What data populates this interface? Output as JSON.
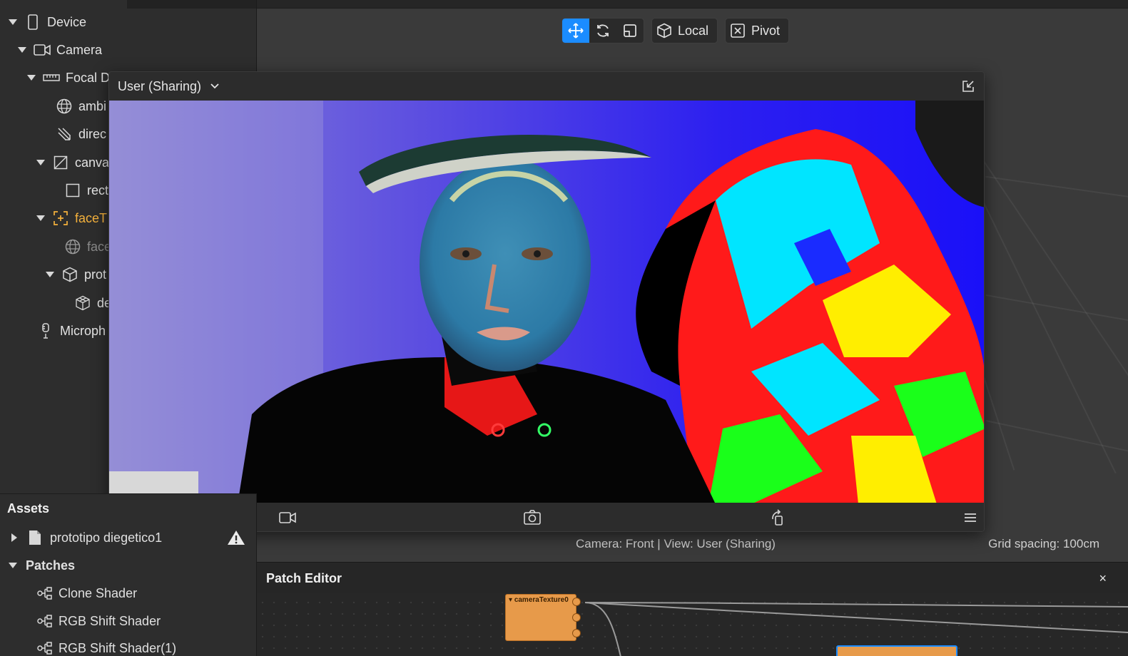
{
  "scene": {
    "items": [
      {
        "label": "Device",
        "icon": "phone-icon"
      },
      {
        "label": "Camera",
        "icon": "camera-icon"
      },
      {
        "label": "Focal D",
        "icon": "ruler-icon"
      },
      {
        "label": "ambi",
        "icon": "globe-icon"
      },
      {
        "label": "direc",
        "icon": "directional-light-icon"
      },
      {
        "label": "canva",
        "icon": "canvas-icon"
      },
      {
        "label": "rect",
        "icon": "rectangle-icon"
      },
      {
        "label": "faceT",
        "icon": "face-tracker-icon"
      },
      {
        "label": "face",
        "icon": "globe-icon"
      },
      {
        "label": "prot",
        "icon": "cube-icon"
      },
      {
        "label": "de",
        "icon": "mesh-icon"
      },
      {
        "label": "Microph",
        "icon": "microphone-icon"
      }
    ]
  },
  "toolbar": {
    "local_label": "Local",
    "pivot_label": "Pivot"
  },
  "simulator": {
    "view_select": "User (Sharing)"
  },
  "viewport": {
    "camera_status": "Camera: Front | View: User (Sharing)",
    "grid_status": "Grid spacing: 100cm"
  },
  "assets": {
    "title": "Assets",
    "project_file": "prototipo diegetico1",
    "patches_label": "Patches",
    "patches": [
      "Clone Shader",
      "RGB Shift Shader",
      "RGB Shift Shader(1)"
    ]
  },
  "patch_editor": {
    "title": "Patch Editor",
    "close_label": "×",
    "node_label": "cameraTexture0"
  },
  "colors": {
    "accent": "#1b8cff",
    "face_tracker": "#f4b13c",
    "patch_node": "#e79a4a"
  }
}
